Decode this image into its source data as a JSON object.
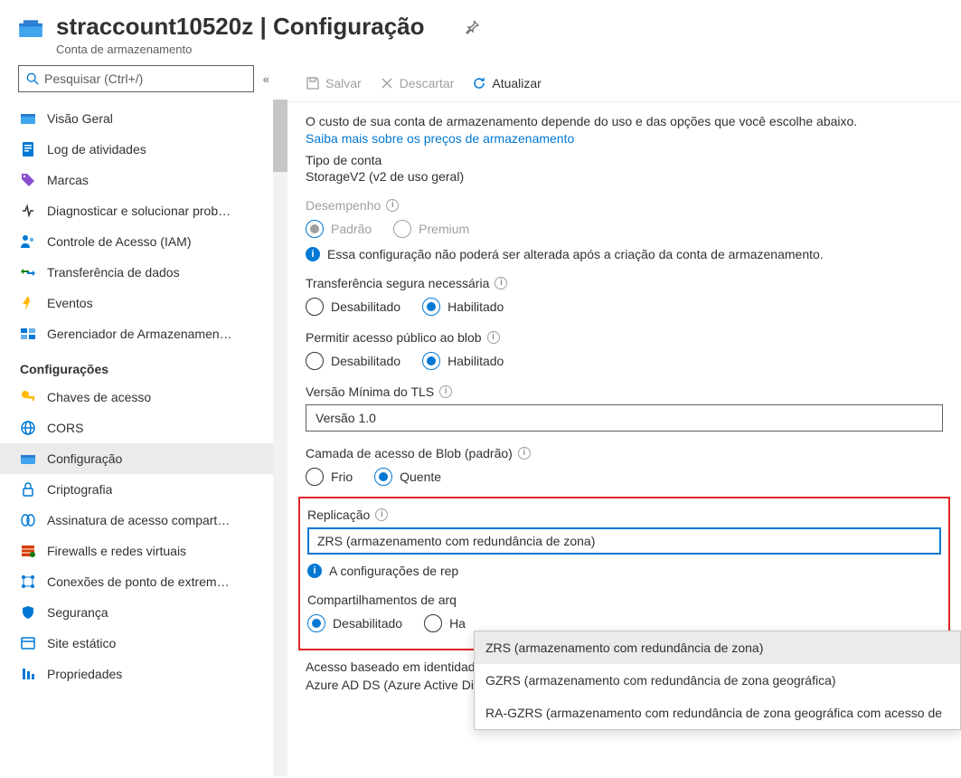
{
  "header": {
    "title": "straccount10520z | Configuração",
    "subtitle": "Conta de armazenamento"
  },
  "search": {
    "placeholder": "Pesquisar (Ctrl+/)"
  },
  "sidebar": {
    "section1": [
      {
        "label": "Visão Geral",
        "icon": "overview"
      },
      {
        "label": "Log de atividades",
        "icon": "activity"
      },
      {
        "label": "Marcas",
        "icon": "tag"
      },
      {
        "label": "Diagnosticar e solucionar prob…",
        "icon": "diagnose"
      },
      {
        "label": "Controle de Acesso (IAM)",
        "icon": "iam"
      },
      {
        "label": "Transferência de dados",
        "icon": "transfer"
      },
      {
        "label": "Eventos",
        "icon": "events"
      },
      {
        "label": "Gerenciador de Armazenamen…",
        "icon": "manager"
      }
    ],
    "section2_title": "Configurações",
    "section2": [
      {
        "label": "Chaves de acesso",
        "icon": "key"
      },
      {
        "label": "CORS",
        "icon": "cors"
      },
      {
        "label": "Configuração",
        "icon": "config",
        "selected": true
      },
      {
        "label": "Criptografia",
        "icon": "lock"
      },
      {
        "label": "Assinatura de acesso compart…",
        "icon": "sas"
      },
      {
        "label": "Firewalls e redes virtuais",
        "icon": "firewall"
      },
      {
        "label": "Conexões de ponto de extrem…",
        "icon": "endpoint"
      },
      {
        "label": "Segurança",
        "icon": "security"
      },
      {
        "label": "Site estático",
        "icon": "site"
      },
      {
        "label": "Propriedades",
        "icon": "props"
      }
    ]
  },
  "toolbar": {
    "save": "Salvar",
    "discard": "Descartar",
    "refresh": "Atualizar"
  },
  "content": {
    "cost_desc": "O custo de sua conta de armazenamento depende do uso e das opções que você escolhe abaixo.",
    "pricing_link": "Saiba mais sobre os preços de armazenamento",
    "account_type_label": "Tipo de conta",
    "account_type_value": "StorageV2 (v2 de uso geral)",
    "performance_label": "Desempenho",
    "perf_option1": "Padrão",
    "perf_option2": "Premium",
    "perf_note": "Essa configuração não poderá ser alterada após a criação da conta de armazenamento.",
    "secure_transfer_label": "Transferência segura necessária",
    "opt_disabled": "Desabilitado",
    "opt_enabled": "Habilitado",
    "blob_public_label": "Permitir acesso público ao blob",
    "tls_label": "Versão Mínima do TLS",
    "tls_value": "Versão 1.0",
    "blob_tier_label": "Camada de acesso de Blob (padrão)",
    "tier_cool": "Frio",
    "tier_hot": "Quente",
    "replication_label": "Replicação",
    "replication_value": "ZRS (armazenamento com redundância de zona)",
    "replication_note_prefix": "A configurações de rep",
    "large_file_label": "Compartilhamentos de arq",
    "large_file_suffix": "Ha",
    "identity_label": "Acesso baseado em identidade para compartilhamentos de arquivo",
    "azure_ad_label": "Azure AD DS (Azure Active Directory Domain Services)"
  },
  "dropdown": {
    "items": [
      "ZRS (armazenamento com redundância de zona)",
      "GZRS (armazenamento com redundância de zona geográfica)",
      "RA-GZRS (armazenamento com redundância de zona geográfica com acesso de"
    ]
  }
}
